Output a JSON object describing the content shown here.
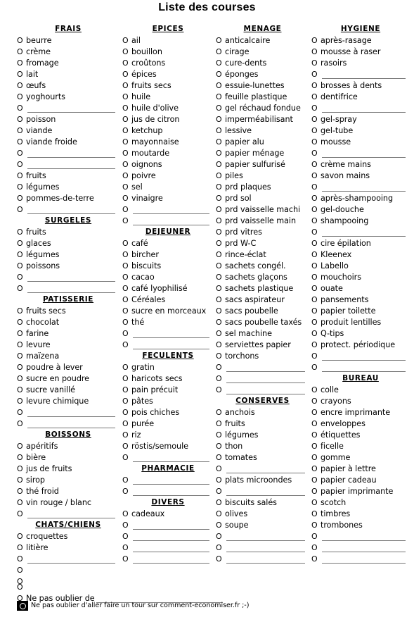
{
  "document": {
    "title": "Liste des courses"
  },
  "footer": {
    "reminder_label": "Ne pas oublier de",
    "promo_text": "Ne pas oublier d'aller faire un tour sur comment-economiser.fr ;-)",
    "promo_mark_icon": "filled-checkbox-icon"
  },
  "bullet_glyph": "O",
  "columns": [
    {
      "name": "column-1",
      "blocks": [
        {
          "heading": "FRAIS",
          "items": [
            {
              "label": "beurre"
            },
            {
              "label": "crème"
            },
            {
              "label": "fromage"
            },
            {
              "label": "lait"
            },
            {
              "label": "œufs"
            },
            {
              "label": "yoghourts"
            },
            {
              "label": "",
              "blank": true
            },
            {
              "label": "poisson"
            },
            {
              "label": "viande"
            },
            {
              "label": "viande froide"
            },
            {
              "label": "",
              "blank": true
            },
            {
              "label": "",
              "blank": true
            },
            {
              "label": "fruits"
            },
            {
              "label": "légumes"
            },
            {
              "label": "pommes-de-terre"
            },
            {
              "label": "",
              "blank": true
            }
          ]
        },
        {
          "heading": "SURGELES",
          "items": [
            {
              "label": "fruits"
            },
            {
              "label": "glaces"
            },
            {
              "label": "légumes"
            },
            {
              "label": "poissons"
            },
            {
              "label": "",
              "blank": true
            },
            {
              "label": "",
              "blank": true
            }
          ]
        },
        {
          "heading": "PATISSERIE",
          "items": [
            {
              "label": "fruits secs"
            },
            {
              "label": "chocolat"
            },
            {
              "label": "farine"
            },
            {
              "label": "levure"
            },
            {
              "label": "maïzena"
            },
            {
              "label": "poudre à lever"
            },
            {
              "label": "sucre en poudre"
            },
            {
              "label": "sucre vanillé"
            },
            {
              "label": "levure chimique"
            },
            {
              "label": "",
              "blank": true
            },
            {
              "label": "",
              "blank": true
            }
          ]
        },
        {
          "heading": "BOISSONS",
          "items": [
            {
              "label": "apéritifs"
            },
            {
              "label": "bière"
            },
            {
              "label": "jus de fruits"
            },
            {
              "label": "sirop"
            },
            {
              "label": "thé froid"
            },
            {
              "label": "vin rouge / blanc"
            },
            {
              "label": "",
              "blank": true
            }
          ]
        },
        {
          "heading": "CHATS/CHIENS",
          "items": [
            {
              "label": "croquettes"
            },
            {
              "label": "litière"
            },
            {
              "label": "",
              "blank": true
            },
            {
              "label": "",
              "blank": false,
              "empty": true
            },
            {
              "label": "",
              "blank": false,
              "empty": true
            }
          ]
        }
      ]
    },
    {
      "name": "column-2",
      "blocks": [
        {
          "heading": "EPICES",
          "items": [
            {
              "label": "ail"
            },
            {
              "label": "bouillon"
            },
            {
              "label": "croûtons"
            },
            {
              "label": "épices"
            },
            {
              "label": "fruits secs"
            },
            {
              "label": "huile"
            },
            {
              "label": "huile d'olive"
            },
            {
              "label": "jus de citron"
            },
            {
              "label": "ketchup"
            },
            {
              "label": "mayonnaise"
            },
            {
              "label": "moutarde"
            },
            {
              "label": "oignons"
            },
            {
              "label": "poivre"
            },
            {
              "label": "sel"
            },
            {
              "label": "vinaigre"
            },
            {
              "label": "",
              "blank": true
            },
            {
              "label": "",
              "blank": true
            }
          ]
        },
        {
          "heading": "DEJEUNER",
          "items": [
            {
              "label": "café"
            },
            {
              "label": "bircher"
            },
            {
              "label": "biscuits"
            },
            {
              "label": "cacao"
            },
            {
              "label": "café lyophilisé"
            },
            {
              "label": "Céréales"
            },
            {
              "label": "sucre en morceaux"
            },
            {
              "label": "thé"
            },
            {
              "label": "",
              "blank": true
            },
            {
              "label": "",
              "blank": true
            }
          ]
        },
        {
          "heading": "FECULENTS",
          "items": [
            {
              "label": "gratin"
            },
            {
              "label": "haricots secs"
            },
            {
              "label": "pain précuit"
            },
            {
              "label": "pâtes"
            },
            {
              "label": "pois chiches"
            },
            {
              "label": "purée"
            },
            {
              "label": "riz"
            },
            {
              "label": "röstis/semoule"
            },
            {
              "label": "",
              "blank": true
            }
          ]
        },
        {
          "heading": "PHARMACIE",
          "items": [
            {
              "label": "",
              "blank": true
            },
            {
              "label": "",
              "blank": true
            }
          ]
        },
        {
          "heading": "DIVERS",
          "items": [
            {
              "label": "cadeaux"
            },
            {
              "label": "",
              "blank": true
            },
            {
              "label": "",
              "blank": true
            },
            {
              "label": "",
              "blank": true
            },
            {
              "label": "",
              "blank": true
            }
          ]
        }
      ]
    },
    {
      "name": "column-3",
      "blocks": [
        {
          "heading": "MENAGE",
          "items": [
            {
              "label": "anticalcaire"
            },
            {
              "label": "cirage"
            },
            {
              "label": "cure-dents"
            },
            {
              "label": "éponges"
            },
            {
              "label": "essuie-lunettes"
            },
            {
              "label": "feuille plastique"
            },
            {
              "label": "gel réchaud fondue"
            },
            {
              "label": "imperméabilisant"
            },
            {
              "label": "lessive"
            },
            {
              "label": "papier alu"
            },
            {
              "label": "papier ménage"
            },
            {
              "label": "papier sulfurisé"
            },
            {
              "label": "piles"
            },
            {
              "label": "prd plaques"
            },
            {
              "label": "prd sol"
            },
            {
              "label": "prd vaisselle machi"
            },
            {
              "label": "prd vaisselle main"
            },
            {
              "label": "prd vitres"
            },
            {
              "label": "prd W-C"
            },
            {
              "label": "rince-éclat"
            },
            {
              "label": "sachets congél."
            },
            {
              "label": "sachets glaçons"
            },
            {
              "label": "sachets plastique"
            },
            {
              "label": "sacs aspirateur"
            },
            {
              "label": "sacs poubelle"
            },
            {
              "label": "sacs poubelle taxés"
            },
            {
              "label": "sel machine"
            },
            {
              "label": "serviettes papier"
            },
            {
              "label": "torchons"
            },
            {
              "label": "",
              "blank": true
            },
            {
              "label": "",
              "blank": true
            },
            {
              "label": "",
              "blank": true
            }
          ]
        },
        {
          "heading": "CONSERVES",
          "items": [
            {
              "label": "anchois"
            },
            {
              "label": "fruits"
            },
            {
              "label": "légumes"
            },
            {
              "label": "thon"
            },
            {
              "label": "tomates"
            },
            {
              "label": "",
              "blank": true
            },
            {
              "label": "plats microondes"
            },
            {
              "label": "",
              "blank": true
            },
            {
              "label": "biscuits salés"
            },
            {
              "label": "olives"
            },
            {
              "label": "soupe"
            },
            {
              "label": "",
              "blank": true
            },
            {
              "label": "",
              "blank": true
            },
            {
              "label": "",
              "blank": true
            }
          ]
        }
      ]
    },
    {
      "name": "column-4",
      "blocks": [
        {
          "heading": "HYGIENE",
          "items": [
            {
              "label": "après-rasage"
            },
            {
              "label": "mousse à raser"
            },
            {
              "label": "rasoirs"
            },
            {
              "label": "",
              "blank": true
            },
            {
              "label": "brosses à dents"
            },
            {
              "label": "dentifrice"
            },
            {
              "label": "",
              "blank": true
            },
            {
              "label": "gel-spray"
            },
            {
              "label": "gel-tube"
            },
            {
              "label": "mousse"
            },
            {
              "label": "",
              "blank": true
            },
            {
              "label": "crème mains"
            },
            {
              "label": "savon mains"
            },
            {
              "label": "",
              "blank": true
            },
            {
              "label": "après-shampooing"
            },
            {
              "label": "gel-douche"
            },
            {
              "label": "shampooing"
            },
            {
              "label": "",
              "blank": true
            },
            {
              "label": "cire épilation"
            },
            {
              "label": "Kleenex"
            },
            {
              "label": "Labello"
            },
            {
              "label": "mouchoirs"
            },
            {
              "label": "ouate"
            },
            {
              "label": "pansements"
            },
            {
              "label": "papier toilette"
            },
            {
              "label": "produit lentilles"
            },
            {
              "label": "Q-tips"
            },
            {
              "label": "protect. périodique"
            },
            {
              "label": "",
              "blank": true
            },
            {
              "label": "",
              "blank": true
            }
          ]
        },
        {
          "heading": "BUREAU",
          "items": [
            {
              "label": "colle"
            },
            {
              "label": "crayons"
            },
            {
              "label": "encre imprimante"
            },
            {
              "label": "enveloppes"
            },
            {
              "label": "étiquettes"
            },
            {
              "label": "ficelle"
            },
            {
              "label": "gomme"
            },
            {
              "label": "papier à lettre"
            },
            {
              "label": "papier cadeau"
            },
            {
              "label": "papier imprimante"
            },
            {
              "label": "scotch"
            },
            {
              "label": "timbres"
            },
            {
              "label": "trombones"
            },
            {
              "label": "",
              "blank": true
            },
            {
              "label": "",
              "blank": true
            },
            {
              "label": "",
              "blank": true
            }
          ]
        }
      ]
    }
  ]
}
